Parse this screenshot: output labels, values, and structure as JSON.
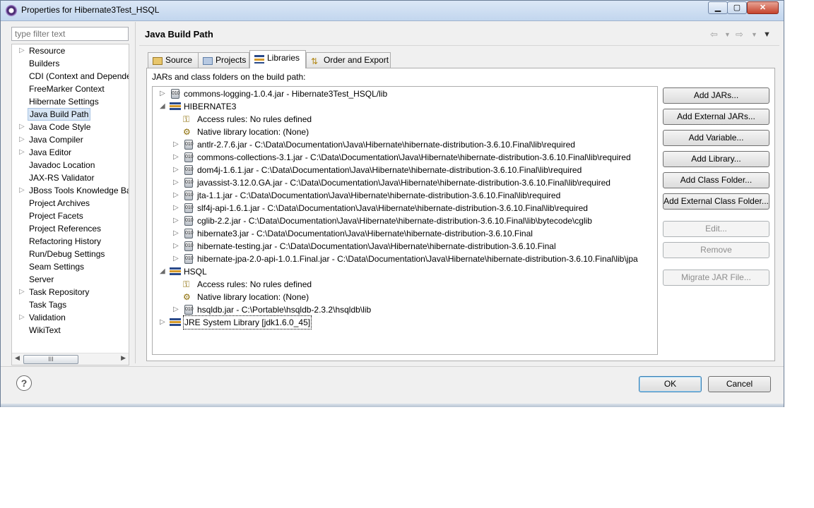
{
  "window": {
    "title": "Properties for Hibernate3Test_HSQL",
    "min": "▁",
    "max": "▢",
    "close": "✕"
  },
  "filter": {
    "placeholder": "type filter text"
  },
  "nav": {
    "items": [
      {
        "label": "Resource",
        "expandable": true
      },
      {
        "label": "Builders",
        "expandable": false
      },
      {
        "label": "CDI (Context and Dependenc",
        "expandable": false
      },
      {
        "label": "FreeMarker Context",
        "expandable": false
      },
      {
        "label": "Hibernate Settings",
        "expandable": false
      },
      {
        "label": "Java Build Path",
        "expandable": false,
        "selected": true
      },
      {
        "label": "Java Code Style",
        "expandable": true
      },
      {
        "label": "Java Compiler",
        "expandable": true
      },
      {
        "label": "Java Editor",
        "expandable": true
      },
      {
        "label": "Javadoc Location",
        "expandable": false
      },
      {
        "label": "JAX-RS Validator",
        "expandable": false
      },
      {
        "label": "JBoss Tools Knowledge Bas",
        "expandable": true
      },
      {
        "label": "Project Archives",
        "expandable": false
      },
      {
        "label": "Project Facets",
        "expandable": false
      },
      {
        "label": "Project References",
        "expandable": false
      },
      {
        "label": "Refactoring History",
        "expandable": false
      },
      {
        "label": "Run/Debug Settings",
        "expandable": false
      },
      {
        "label": "Seam Settings",
        "expandable": false
      },
      {
        "label": "Server",
        "expandable": false
      },
      {
        "label": "Task Repository",
        "expandable": true
      },
      {
        "label": "Task Tags",
        "expandable": false
      },
      {
        "label": "Validation",
        "expandable": true
      },
      {
        "label": "WikiText",
        "expandable": false
      }
    ],
    "scroll_thumb": "III"
  },
  "page": {
    "title": "Java Build Path"
  },
  "tabs": [
    {
      "label": "Source",
      "icon": "source-folder-icon"
    },
    {
      "label": "Projects",
      "icon": "projects-icon"
    },
    {
      "label": "Libraries",
      "icon": "libraries-icon",
      "active": true
    },
    {
      "label": "Order and Export",
      "icon": "order-export-icon"
    }
  ],
  "libraries": {
    "caption": "JARs and class folders on the build path:",
    "rows": [
      {
        "level": 0,
        "exp": "▷",
        "icon": "jar",
        "text": "commons-logging-1.0.4.jar - Hibernate3Test_HSQL/lib"
      },
      {
        "level": 0,
        "exp": "◢",
        "icon": "lib",
        "text": "HIBERNATE3"
      },
      {
        "level": 1,
        "exp": "",
        "icon": "rule",
        "text": "Access rules: No rules defined"
      },
      {
        "level": 1,
        "exp": "",
        "icon": "native",
        "text": "Native library location: (None)"
      },
      {
        "level": 1,
        "exp": "▷",
        "icon": "jar",
        "text": "antlr-2.7.6.jar - C:\\Data\\Documentation\\Java\\Hibernate\\hibernate-distribution-3.6.10.Final\\lib\\required"
      },
      {
        "level": 1,
        "exp": "▷",
        "icon": "jar",
        "text": "commons-collections-3.1.jar - C:\\Data\\Documentation\\Java\\Hibernate\\hibernate-distribution-3.6.10.Final\\lib\\required"
      },
      {
        "level": 1,
        "exp": "▷",
        "icon": "jar",
        "text": "dom4j-1.6.1.jar - C:\\Data\\Documentation\\Java\\Hibernate\\hibernate-distribution-3.6.10.Final\\lib\\required"
      },
      {
        "level": 1,
        "exp": "▷",
        "icon": "jar",
        "text": "javassist-3.12.0.GA.jar - C:\\Data\\Documentation\\Java\\Hibernate\\hibernate-distribution-3.6.10.Final\\lib\\required"
      },
      {
        "level": 1,
        "exp": "▷",
        "icon": "jar",
        "text": "jta-1.1.jar - C:\\Data\\Documentation\\Java\\Hibernate\\hibernate-distribution-3.6.10.Final\\lib\\required"
      },
      {
        "level": 1,
        "exp": "▷",
        "icon": "jar",
        "text": "slf4j-api-1.6.1.jar - C:\\Data\\Documentation\\Java\\Hibernate\\hibernate-distribution-3.6.10.Final\\lib\\required"
      },
      {
        "level": 1,
        "exp": "▷",
        "icon": "jar",
        "text": "cglib-2.2.jar - C:\\Data\\Documentation\\Java\\Hibernate\\hibernate-distribution-3.6.10.Final\\lib\\bytecode\\cglib"
      },
      {
        "level": 1,
        "exp": "▷",
        "icon": "jar",
        "text": "hibernate3.jar - C:\\Data\\Documentation\\Java\\Hibernate\\hibernate-distribution-3.6.10.Final"
      },
      {
        "level": 1,
        "exp": "▷",
        "icon": "jar",
        "text": "hibernate-testing.jar - C:\\Data\\Documentation\\Java\\Hibernate\\hibernate-distribution-3.6.10.Final"
      },
      {
        "level": 1,
        "exp": "▷",
        "icon": "jar",
        "text": "hibernate-jpa-2.0-api-1.0.1.Final.jar - C:\\Data\\Documentation\\Java\\Hibernate\\hibernate-distribution-3.6.10.Final\\lib\\jpa"
      },
      {
        "level": 0,
        "exp": "◢",
        "icon": "lib",
        "text": "HSQL"
      },
      {
        "level": 1,
        "exp": "",
        "icon": "rule",
        "text": "Access rules: No rules defined"
      },
      {
        "level": 1,
        "exp": "",
        "icon": "native",
        "text": "Native library location: (None)"
      },
      {
        "level": 1,
        "exp": "▷",
        "icon": "jar",
        "text": "hsqldb.jar - C:\\Portable\\hsqldb-2.3.2\\hsqldb\\lib"
      },
      {
        "level": 0,
        "exp": "▷",
        "icon": "lib",
        "text": "JRE System Library [jdk1.6.0_45]",
        "focused": true
      }
    ]
  },
  "buttons": [
    {
      "label": "Add JARs...",
      "enabled": true
    },
    {
      "label": "Add External JARs...",
      "enabled": true
    },
    {
      "label": "Add Variable...",
      "enabled": true
    },
    {
      "label": "Add Library...",
      "enabled": true
    },
    {
      "label": "Add Class Folder...",
      "enabled": true
    },
    {
      "label": "Add External Class Folder...",
      "enabled": true
    },
    {
      "label": "Edit...",
      "enabled": false
    },
    {
      "label": "Remove",
      "enabled": false
    },
    {
      "label": "Migrate JAR File...",
      "enabled": false
    }
  ],
  "dialog": {
    "help": "?",
    "ok": "OK",
    "cancel": "Cancel"
  },
  "colors": {
    "selection": "#d8e6f5",
    "title_bar": "#c2d6ee",
    "ok_border": "#3c7fb1"
  }
}
